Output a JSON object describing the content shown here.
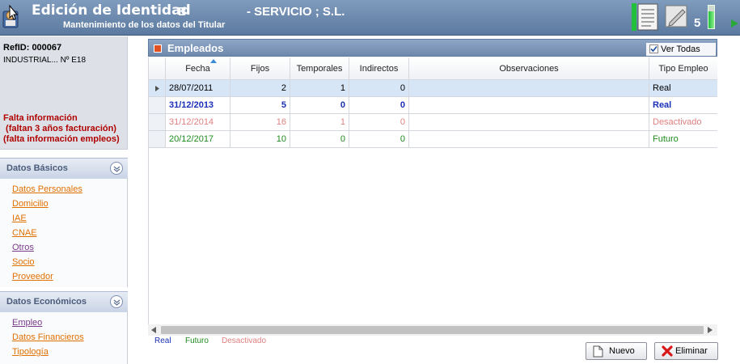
{
  "header": {
    "title": "Edición de Identidad",
    "company_initial": "B",
    "company_name": "- SERVICIO ; S.L.",
    "subtitle": "Mantenimiento de los datos del Titular",
    "counter": "5",
    "level_fraction": 0.75,
    "icons": [
      "app-icon",
      "document-icon",
      "pencil-icon",
      "arrow-icon"
    ]
  },
  "ref": {
    "id": "RefID: 000067",
    "company": "INDUSTRIAL... Nº E18",
    "warnings": "Falta información\n (faltan 3 años facturación)\n(falta información empleos)"
  },
  "sidebar": {
    "sections": [
      {
        "title": "Datos Básicos",
        "links": [
          "Datos Personales",
          "Domicilio",
          "IAE",
          "CNAE",
          "Otros",
          "Socio",
          "Proveedor"
        ]
      },
      {
        "title": "Datos Económicos",
        "links": [
          "Empleo",
          "Datos Financieros",
          "Tipología"
        ]
      }
    ]
  },
  "panel": {
    "title": "Empleados",
    "ver_todas_label": "Ver Todas",
    "ver_todas_checked": true
  },
  "grid": {
    "columns": [
      "Fecha",
      "Fijos",
      "Temporales",
      "Indirectos",
      "Observaciones",
      "Tipo Empleo"
    ],
    "sorted_column": "Fecha",
    "rows": [
      {
        "fecha": "28/07/2011",
        "fijos": "2",
        "temporales": "1",
        "indirectos": "0",
        "observaciones": "",
        "tipo": "Real",
        "style": "plain",
        "selected": true
      },
      {
        "fecha": "31/12/2013",
        "fijos": "5",
        "temporales": "0",
        "indirectos": "0",
        "observaciones": "",
        "tipo": "Real",
        "style": "real-bold",
        "selected": false
      },
      {
        "fecha": "31/12/2014",
        "fijos": "16",
        "temporales": "1",
        "indirectos": "0",
        "observaciones": "",
        "tipo": "Desactivado",
        "style": "desactivado",
        "selected": false
      },
      {
        "fecha": "20/12/2017",
        "fijos": "10",
        "temporales": "0",
        "indirectos": "0",
        "observaciones": "",
        "tipo": "Futuro",
        "style": "futuro",
        "selected": false
      }
    ]
  },
  "legend": {
    "real": "Real",
    "futuro": "Futuro",
    "desactivado": "Desactivado",
    "colors": {
      "real": "#1a2fb8",
      "futuro": "#1e8a1e",
      "desactivado": "#e08080"
    }
  },
  "buttons": {
    "nuevo": "Nuevo",
    "eliminar": "Eliminar"
  }
}
